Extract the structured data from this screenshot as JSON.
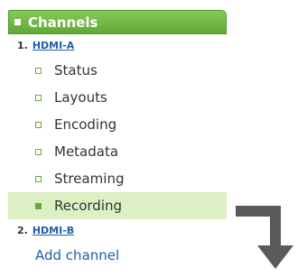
{
  "header": {
    "title": "Channels"
  },
  "channels": [
    {
      "number": "1.",
      "name": "HDMI-A",
      "items": [
        {
          "label": "Status"
        },
        {
          "label": "Layouts"
        },
        {
          "label": "Encoding"
        },
        {
          "label": "Metadata"
        },
        {
          "label": "Streaming"
        },
        {
          "label": "Recording",
          "active": true
        }
      ]
    },
    {
      "number": "2.",
      "name": "HDMI-B"
    }
  ],
  "add_channel": "Add channel",
  "colors": {
    "accent": "#6aaa3a",
    "active_bg": "#dcf0c4",
    "link": "#1f5fa8",
    "arrow": "#5a5a5a"
  },
  "icons": {
    "arrow": "down-turn-arrow-icon"
  }
}
